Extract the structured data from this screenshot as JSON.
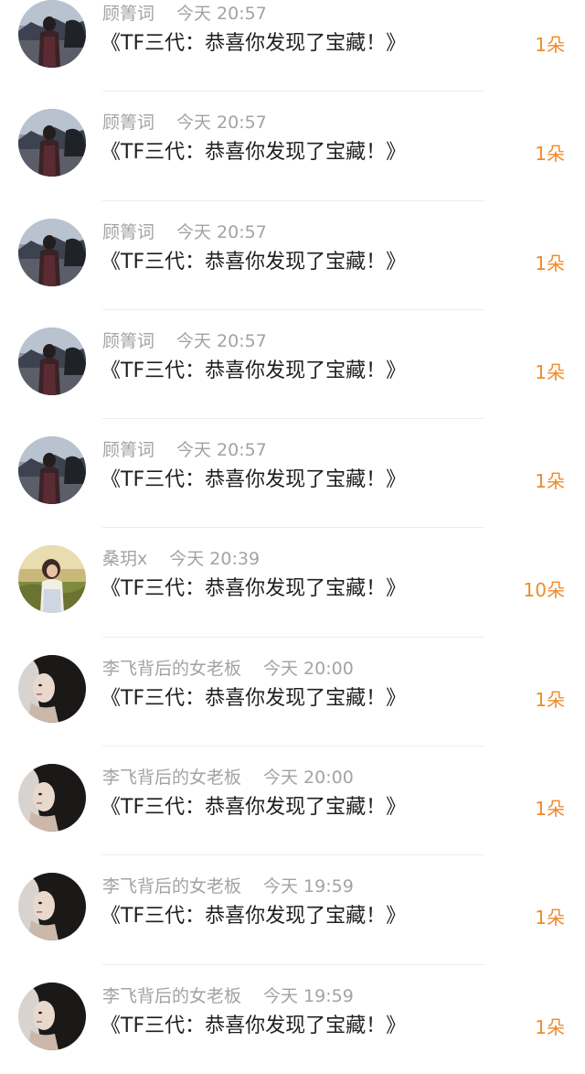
{
  "gifts": [
    {
      "avatar": "avatar-photo-1",
      "name": "顾箐词",
      "time": "今天 20:57",
      "title": "《TF三代：恭喜你发现了宝藏！》",
      "count": "1朵"
    },
    {
      "avatar": "avatar-photo-1",
      "name": "顾箐词",
      "time": "今天 20:57",
      "title": "《TF三代：恭喜你发现了宝藏！》",
      "count": "1朵"
    },
    {
      "avatar": "avatar-photo-1",
      "name": "顾箐词",
      "time": "今天 20:57",
      "title": "《TF三代：恭喜你发现了宝藏！》",
      "count": "1朵"
    },
    {
      "avatar": "avatar-photo-1",
      "name": "顾箐词",
      "time": "今天 20:57",
      "title": "《TF三代：恭喜你发现了宝藏！》",
      "count": "1朵"
    },
    {
      "avatar": "avatar-photo-1",
      "name": "顾箐词",
      "time": "今天 20:57",
      "title": "《TF三代：恭喜你发现了宝藏！》",
      "count": "1朵"
    },
    {
      "avatar": "avatar-photo-2",
      "name": "桑玥x",
      "time": "今天 20:39",
      "title": "《TF三代：恭喜你发现了宝藏！》",
      "count": "10朵"
    },
    {
      "avatar": "avatar-photo-3",
      "name": "李飞背后的女老板",
      "time": "今天 20:00",
      "title": "《TF三代：恭喜你发现了宝藏！》",
      "count": "1朵"
    },
    {
      "avatar": "avatar-photo-3",
      "name": "李飞背后的女老板",
      "time": "今天 20:00",
      "title": "《TF三代：恭喜你发现了宝藏！》",
      "count": "1朵"
    },
    {
      "avatar": "avatar-photo-3",
      "name": "李飞背后的女老板",
      "time": "今天 19:59",
      "title": "《TF三代：恭喜你发现了宝藏！》",
      "count": "1朵"
    },
    {
      "avatar": "avatar-photo-3",
      "name": "李飞背后的女老板",
      "time": "今天 19:59",
      "title": "《TF三代：恭喜你发现了宝藏！》",
      "count": "1朵"
    }
  ],
  "colors": {
    "meta_text": "#a3a3a3",
    "title_text": "#1f1f1f",
    "count_accent": "#ef8a2b",
    "divider": "#ededed"
  }
}
